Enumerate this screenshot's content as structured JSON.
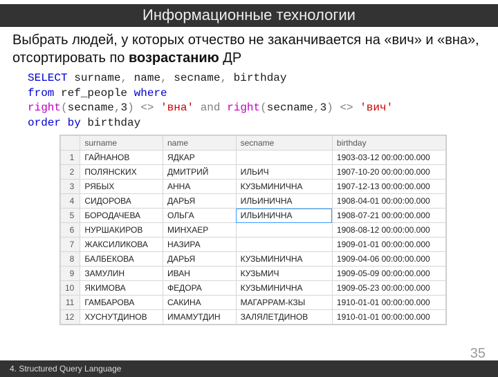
{
  "title": "Информационные технологии",
  "task_pre": "Выбрать людей, у которых отчество не заканчивается на «вич» и «вна», отсортировать по ",
  "task_bold": "возрастанию",
  "task_post": " ДР",
  "code": {
    "k_select": "SELECT",
    "c_surname": " surname",
    "c_name": " name",
    "c_secname": " secname",
    "c_bday": " birthday",
    "k_from": "from",
    "t_ref": " ref_people ",
    "k_where": "where",
    "fn_right": "right",
    "lp": "(",
    "rp": ")",
    "arg_sec": "secname",
    "comma": ",",
    "num3": "3",
    "neq": " <> ",
    "s_vna": "'вна'",
    "k_and": " and ",
    "s_vich": "'вич'",
    "k_orderby": "order by",
    "col_bday": " birthday"
  },
  "headers": [
    "",
    "surname",
    "name",
    "secname",
    "birthday"
  ],
  "rows": [
    [
      "1",
      "ГАЙНАНОВ",
      "ЯДКАР",
      "",
      "1903-03-12 00:00:00.000"
    ],
    [
      "2",
      "ПОЛЯНСКИХ",
      "ДМИТРИЙ",
      "ИЛЬИЧ",
      "1907-10-20 00:00:00.000"
    ],
    [
      "3",
      "РЯБЫХ",
      "АННА",
      "КУЗЬМИНИЧНА",
      "1907-12-13 00:00:00.000"
    ],
    [
      "4",
      "СИДОРОВА",
      "ДАРЬЯ",
      "ИЛЬИНИЧНА",
      "1908-04-01 00:00:00.000"
    ],
    [
      "5",
      "БОРОДАЧЕВА",
      "ОЛЬГА",
      "ИЛЬИНИЧНА",
      "1908-07-21 00:00:00.000"
    ],
    [
      "6",
      "НУРШАКИРОВ",
      "МИНХАЕР",
      "",
      "1908-08-12 00:00:00.000"
    ],
    [
      "7",
      "ЖАКСИЛИКОВА",
      "НАЗИРА",
      "",
      "1909-01-01 00:00:00.000"
    ],
    [
      "8",
      "БАЛБЕКОВА",
      "ДАРЬЯ",
      "КУЗЬМИНИЧНА",
      "1909-04-06 00:00:00.000"
    ],
    [
      "9",
      "ЗАМУЛИН",
      "ИВАН",
      "КУЗЬМИЧ",
      "1909-05-09 00:00:00.000"
    ],
    [
      "10",
      "ЯКИМОВА",
      "ФЕДОРА",
      "КУЗЬМИНИЧНА",
      "1909-05-23 00:00:00.000"
    ],
    [
      "11",
      "ГАМБАРОВА",
      "САКИНА",
      "МАГАРРАМ-КЗЫ",
      "1910-01-01 00:00:00.000"
    ],
    [
      "12",
      "ХУСНУТДИНОВ",
      "ИМАМУТДИН",
      "ЗАЛЯЛЕТДИНОВ",
      "1910-01-01 00:00:00.000"
    ]
  ],
  "selected_cell": [
    4,
    3
  ],
  "footer": "4. Structured Query Language",
  "slide_number": "35"
}
